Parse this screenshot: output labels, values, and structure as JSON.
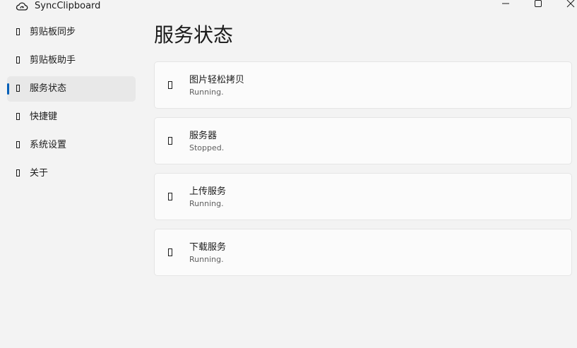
{
  "window": {
    "title": "SyncClipboard",
    "app_icon": "cloud-sync-icon",
    "controls": [
      "minimize-icon",
      "maximize-icon",
      "close-icon"
    ]
  },
  "sidebar": {
    "items": [
      {
        "label": "剪贴板同步",
        "icon": "placeholder-glyph",
        "selected": false
      },
      {
        "label": "剪贴板助手",
        "icon": "placeholder-glyph",
        "selected": false
      },
      {
        "label": "服务状态",
        "icon": "placeholder-glyph",
        "selected": true
      },
      {
        "label": "快捷键",
        "icon": "placeholder-glyph",
        "selected": false
      },
      {
        "label": "系统设置",
        "icon": "placeholder-glyph",
        "selected": false
      },
      {
        "label": "关于",
        "icon": "placeholder-glyph",
        "selected": false
      }
    ]
  },
  "main": {
    "title": "服务状态",
    "services": [
      {
        "name": "图片轻松拷贝",
        "status": "Running."
      },
      {
        "name": "服务器",
        "status": "Stopped."
      },
      {
        "name": "上传服务",
        "status": "Running."
      },
      {
        "name": "下载服务",
        "status": "Running."
      }
    ]
  },
  "colors": {
    "accent": "#005fb8",
    "window_background": "#f3f3f3",
    "card_background": "#fbfbfb",
    "selected_background": "#e8e8e8"
  }
}
